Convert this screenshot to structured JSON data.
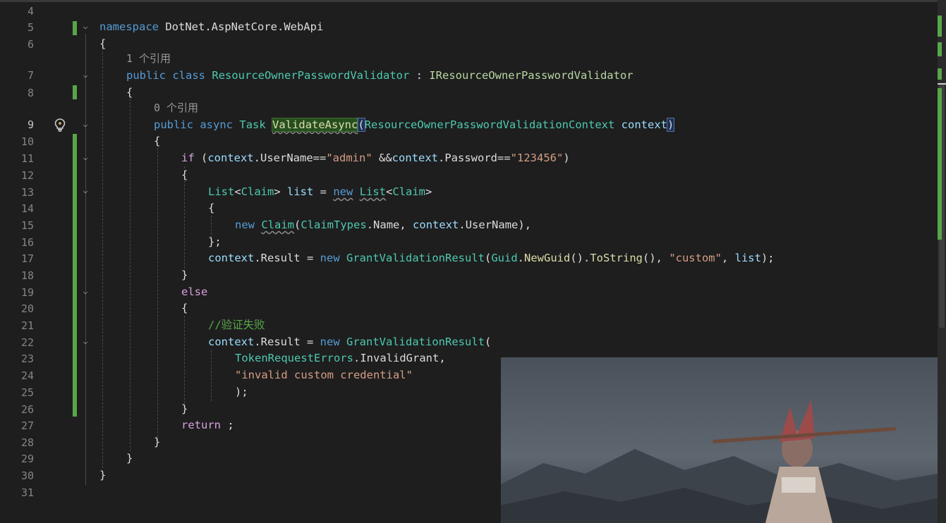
{
  "editor": {
    "line_numbers": [
      "4",
      "5",
      "6",
      "",
      "7",
      "8",
      "",
      "9",
      "10",
      "11",
      "12",
      "13",
      "14",
      "15",
      "16",
      "17",
      "18",
      "19",
      "20",
      "21",
      "22",
      "23",
      "24",
      "25",
      "26",
      "27",
      "28",
      "29",
      "30",
      "31"
    ],
    "codelens": {
      "class_refs": "1 个引用",
      "method_refs": "0 个引用"
    },
    "tokens": {
      "namespace_kw": "namespace",
      "namespace_name": "DotNet.AspNetCore.WebApi",
      "public_kw": "public",
      "class_kw": "class",
      "class_name": "ResourceOwnerPasswordValidator",
      "colon": " : ",
      "interface_name": "IResourceOwnerPasswordValidator",
      "async_kw": "async",
      "task_type": "Task",
      "method_name": "ValidateAsync",
      "open_paren": "(",
      "context_type": "ResourceOwnerPasswordValidationContext",
      "context_param": "context",
      "close_paren": ")",
      "if_kw": "if",
      "username_prop": "UserName",
      "admin_str": "\"admin\"",
      "password_prop": "Password",
      "pwd_str": "\"123456\"",
      "list_type": "List",
      "claim_type": "Claim",
      "list_var": "list",
      "new_kw": "new",
      "claimtypes": "ClaimTypes",
      "name_prop": "Name",
      "result_prop": "Result",
      "grant_result": "GrantValidationResult",
      "guid": "Guid",
      "newguid": "NewGuid",
      "tostring": "ToString",
      "custom_str": "\"custom\"",
      "else_kw": "else",
      "comment": "//验证失败",
      "token_errors": "TokenRequestErrors",
      "invalid_grant": "InvalidGrant",
      "invalid_str": "\"invalid custom credential\"",
      "return_kw": "return"
    }
  },
  "colors": {
    "background": "#1e1e1e",
    "keyword": "#569cd6",
    "control": "#d8a0df",
    "type": "#4ec9b0",
    "method": "#dcdcaa",
    "string": "#d69d85",
    "comment": "#57a64a",
    "change_bar": "#57a64a"
  },
  "icons": {
    "lightbulb": "lightbulb-icon",
    "fold": "chevron-down-icon"
  }
}
